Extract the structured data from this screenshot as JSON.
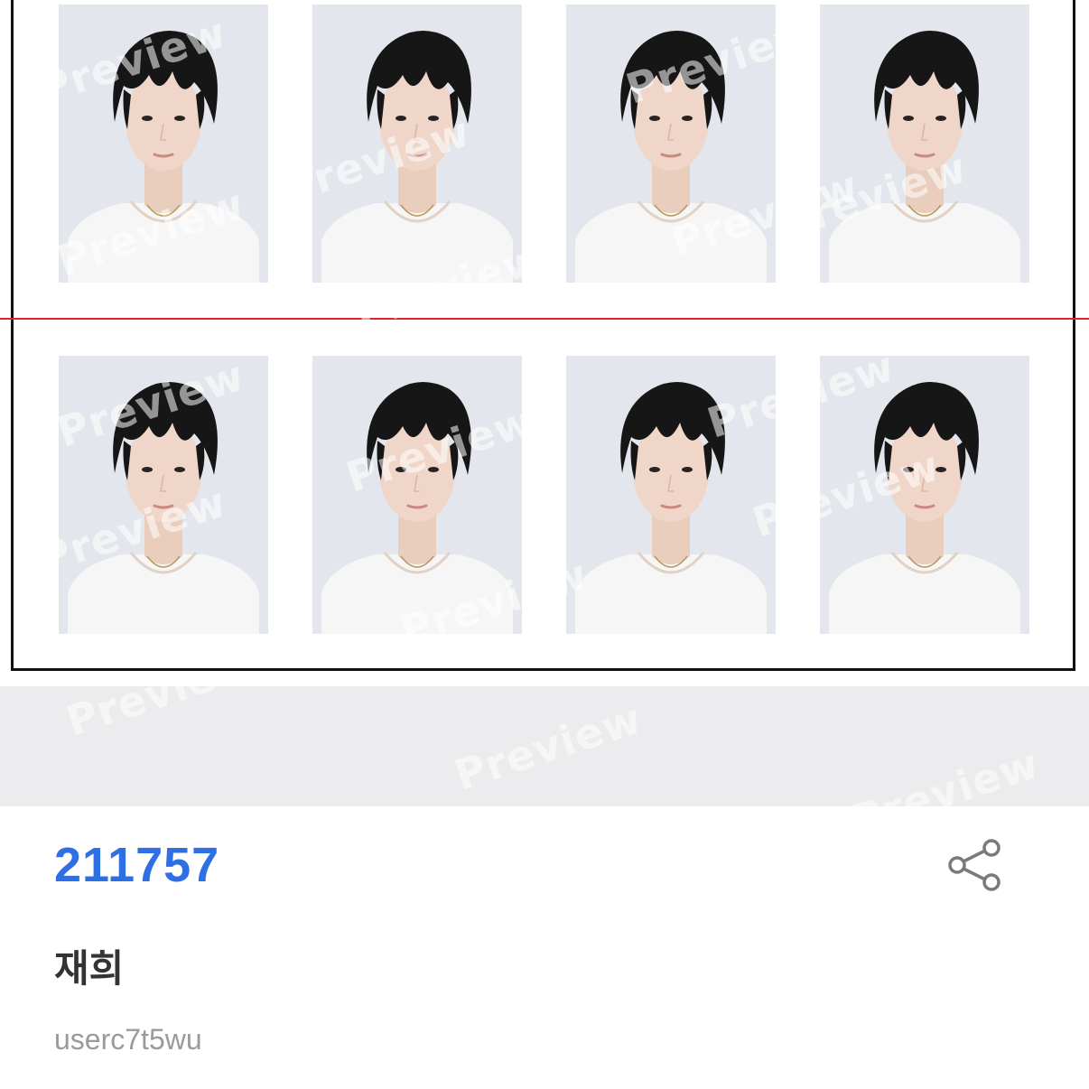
{
  "preview": {
    "watermark_text": "Preview",
    "photo_count": 8,
    "rows": 2,
    "columns": 4,
    "cut_line_color": "#d9262b",
    "background_color": "#e3e6ec"
  },
  "item": {
    "code": "211757",
    "code_color": "#2f6fe4",
    "name": "재희",
    "username": "userc7t5wu"
  },
  "actions": {
    "share_icon": "share-icon"
  }
}
